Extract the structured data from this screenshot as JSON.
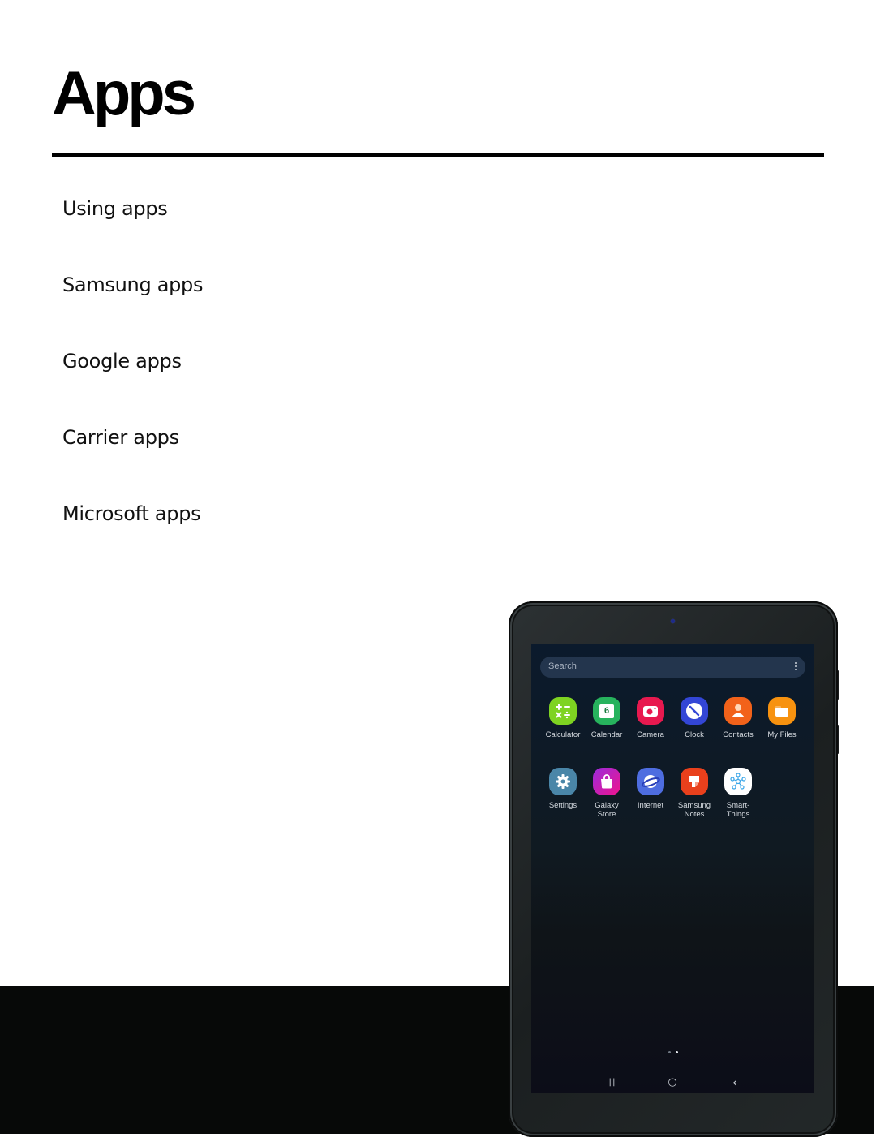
{
  "page": {
    "title": "Apps",
    "toc": [
      {
        "label": "Using apps"
      },
      {
        "label": "Samsung apps"
      },
      {
        "label": "Google apps"
      },
      {
        "label": "Carrier apps"
      },
      {
        "label": "Microsoft apps"
      }
    ]
  },
  "tablet_screen": {
    "search": {
      "placeholder": "Search",
      "more_icon": "more-vertical-icon"
    },
    "apps": [
      {
        "label": "Calculator",
        "icon": "calculator-icon",
        "color": "#7ed321"
      },
      {
        "label": "Calendar",
        "icon": "calendar-icon",
        "color": "#27b35d",
        "badge": "6"
      },
      {
        "label": "Camera",
        "icon": "camera-icon",
        "color": "#e8194f"
      },
      {
        "label": "Clock",
        "icon": "clock-icon",
        "color": "#3346d6"
      },
      {
        "label": "Contacts",
        "icon": "contacts-icon",
        "color": "#f2621a"
      },
      {
        "label": "My Files",
        "icon": "folder-icon",
        "color": "#f7920f"
      },
      {
        "label": "Settings",
        "icon": "gear-icon",
        "color": "#4a86a8"
      },
      {
        "label": "Galaxy\nStore",
        "icon": "shopping-bag-icon",
        "color": "#d81ba6"
      },
      {
        "label": "Internet",
        "icon": "planet-icon",
        "color": "#4e6de0"
      },
      {
        "label": "Samsung\nNotes",
        "icon": "notes-icon",
        "color": "#e9401c"
      },
      {
        "label": "Smart-\nThings",
        "icon": "smartthings-icon",
        "color": "#ffffff"
      }
    ],
    "page_indicator": {
      "pages": 2,
      "current": 2
    },
    "navbar": [
      {
        "name": "recents-button",
        "glyph": "|||"
      },
      {
        "name": "home-button",
        "glyph": "○"
      },
      {
        "name": "back-button",
        "glyph": "‹"
      }
    ]
  }
}
